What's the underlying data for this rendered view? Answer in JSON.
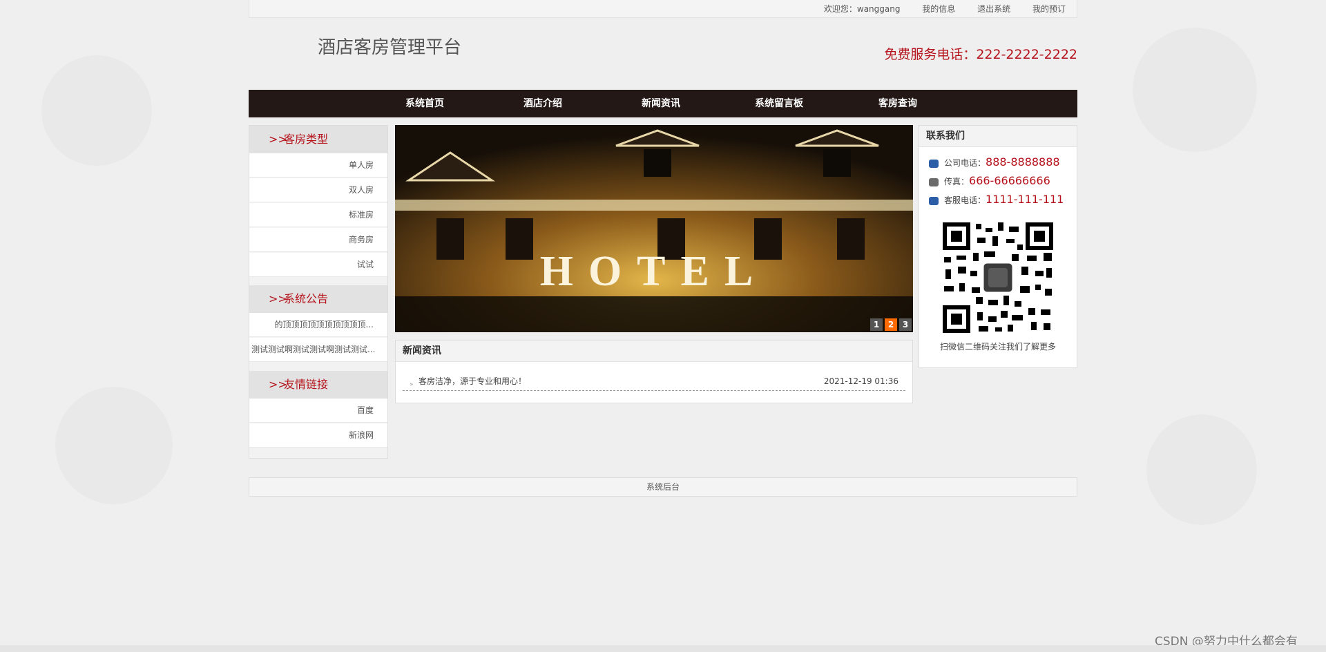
{
  "topbar": {
    "welcome": "欢迎您：wanggang",
    "my_info": "我的信息",
    "logout": "退出系统",
    "my_booking": "我的预订"
  },
  "header": {
    "title": "酒店客房管理平台",
    "hotline": "免费服务电话：222-2222-2222"
  },
  "nav": [
    "系统首页",
    "酒店介绍",
    "新闻资讯",
    "系统留言板",
    "客房查询"
  ],
  "sidebar": {
    "room_types": {
      "heading": "客房类型",
      "items": [
        "单人房",
        "双人房",
        "标准房",
        "商务房",
        "试试"
      ]
    },
    "notices": {
      "heading": "系统公告",
      "items": [
        "的顶顶顶顶顶顶顶顶顶顶...",
        "测试测试啊测试测试啊测试测试..."
      ]
    },
    "links": {
      "heading": "友情链接",
      "items": [
        "百度",
        "新浪网"
      ]
    },
    "arrow": ">>"
  },
  "banner": {
    "sign_text": "HOTEL",
    "slides": [
      "1",
      "2",
      "3"
    ],
    "active_slide": 2
  },
  "news": {
    "heading": "新闻资讯",
    "items": [
      {
        "title": "客房洁净，源于专业和用心！",
        "date": "2021-12-19 01:36"
      }
    ]
  },
  "contact": {
    "heading": "联系我们",
    "company_phone_label": "公司电话：",
    "company_phone": "888-8888888",
    "fax_label": "传真：",
    "fax": "666-66666666",
    "service_phone_label": "客服电话：",
    "service_phone": "1111-111-111",
    "qr_caption": "扫微信二维码关注我们了解更多"
  },
  "footer": {
    "link": "系统后台"
  },
  "watermark": "CSDN @努力中什么都会有",
  "colors": {
    "accent": "#b5121b",
    "nav_bg": "#231815",
    "active_dot": "#ff6a00"
  }
}
